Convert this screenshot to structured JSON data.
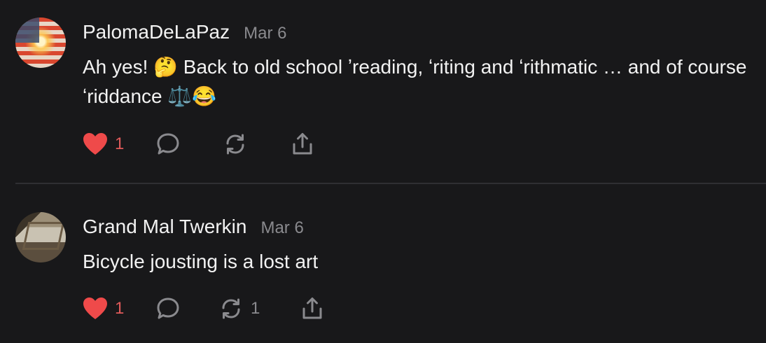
{
  "posts": [
    {
      "username": "PalomaDeLaPaz",
      "date": "Mar 6",
      "text": "Ah yes! 🤔 Back to old school ʼreading, ʻriting and ʻrithmatic … and of course ʻriddance ⚖️😂",
      "avatar_icon": "flag-avatar",
      "like_count": "1",
      "repost_count": ""
    },
    {
      "username": "Grand Mal Twerkin",
      "date": "Mar 6",
      "text": "Bicycle jousting is a lost art",
      "avatar_icon": "photo-avatar",
      "like_count": "1",
      "repost_count": "1"
    }
  ],
  "colors": {
    "background": "#18181a",
    "heart": "#ef4a4a",
    "muted": "#8a8a8e",
    "divider": "#2f2f33"
  }
}
